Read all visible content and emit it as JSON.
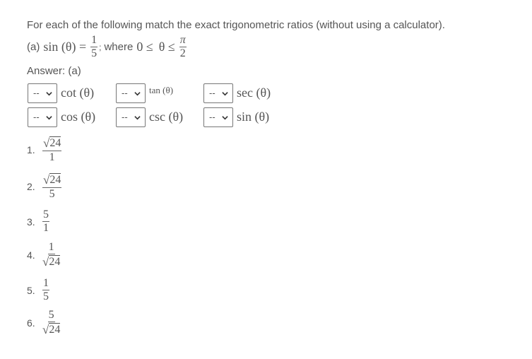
{
  "instructions": "For each of the following match the exact trigonometric ratios (without using a calculator).",
  "problem": {
    "part_label": "(a)",
    "lhs": "sin (θ) =",
    "fraction_num": "1",
    "fraction_den": "5",
    "sep": ";",
    "where_text": "where",
    "constraint_lower": "0 ≤",
    "constraint_var": "θ ≤",
    "pi_num": "π",
    "pi_den": "2"
  },
  "answer_label": "Answer: (a)",
  "matches": [
    {
      "select_value": "--",
      "label": "cot (θ)"
    },
    {
      "select_value": "--",
      "label": "tan (θ)"
    },
    {
      "select_value": "--",
      "label": "sec (θ)"
    },
    {
      "select_value": "--",
      "label": "cos (θ)"
    },
    {
      "select_value": "--",
      "label": "csc (θ)"
    },
    {
      "select_value": "--",
      "label": "sin (θ)"
    }
  ],
  "options": [
    {
      "n": "1.",
      "num": "24",
      "num_sqrt": true,
      "den": "1",
      "den_sqrt": false
    },
    {
      "n": "2.",
      "num": "24",
      "num_sqrt": true,
      "den": "5",
      "den_sqrt": false
    },
    {
      "n": "3.",
      "num": "5",
      "num_sqrt": false,
      "den": "1",
      "den_sqrt": false
    },
    {
      "n": "4.",
      "num": "1",
      "num_sqrt": false,
      "den": "24",
      "den_sqrt": true
    },
    {
      "n": "5.",
      "num": "1",
      "num_sqrt": false,
      "den": "5",
      "den_sqrt": false
    },
    {
      "n": "6.",
      "num": "5",
      "num_sqrt": false,
      "den": "24",
      "den_sqrt": true
    }
  ]
}
